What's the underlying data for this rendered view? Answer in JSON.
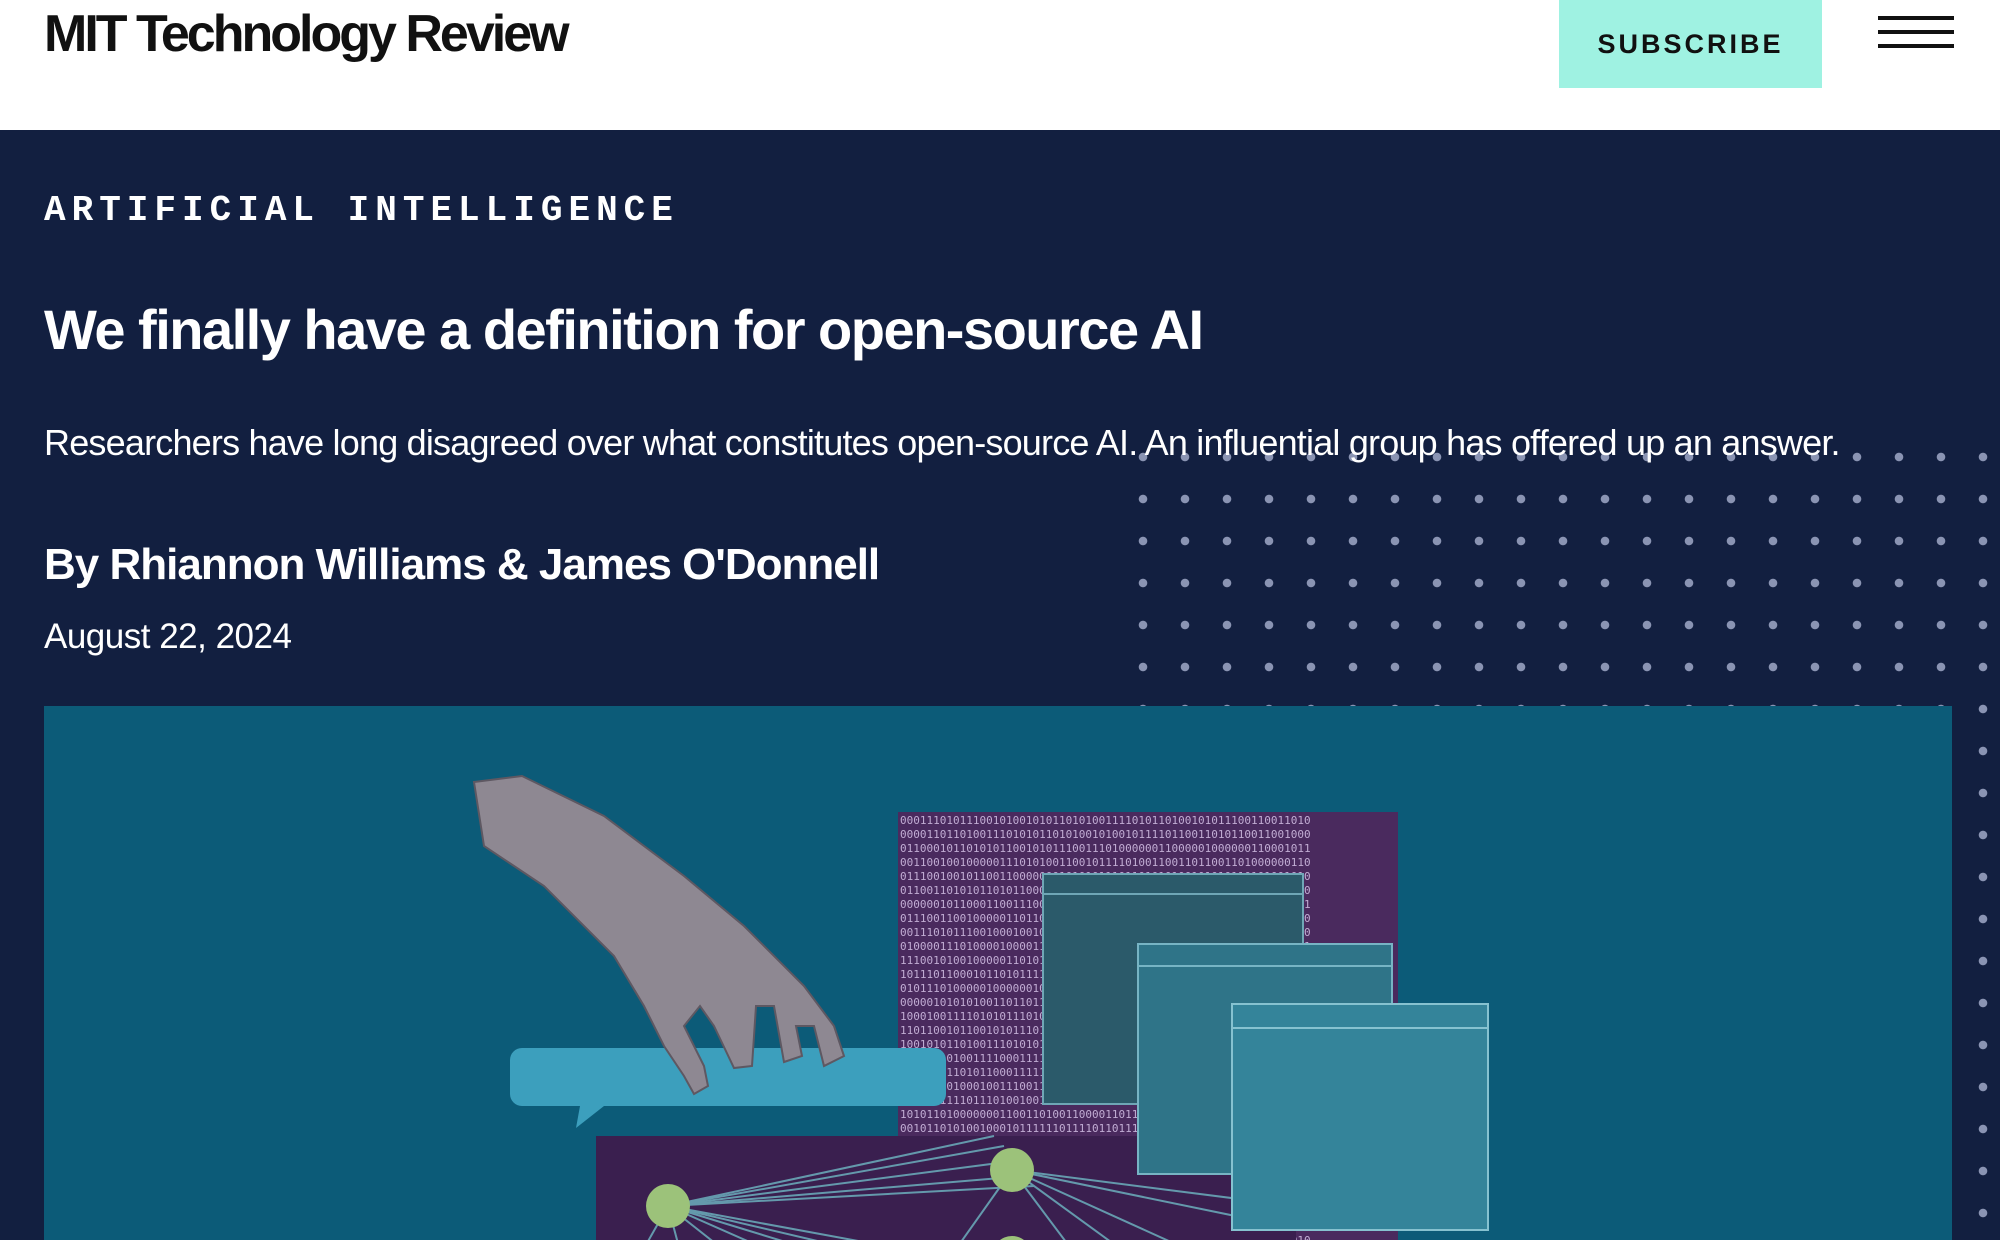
{
  "header": {
    "logo": "MIT Technology Review",
    "subscribe_label": "SUBSCRIBE",
    "menu_icon": "hamburger-menu-icon"
  },
  "article": {
    "category": "ARTIFICIAL INTELLIGENCE",
    "title": "We finally have a definition for open-source AI",
    "dek": "Researchers have long disagreed over what constitutes open-source AI. An influential group has offered up an answer.",
    "byline_prefix": "By ",
    "author1": "Rhiannon Williams",
    "byline_joiner": " & ",
    "author2": "James O'Donnell",
    "date": "August 22, 2024"
  },
  "colors": {
    "hero_background": "#121f40",
    "subscribe_background": "#9ff2e2",
    "image_background": "#0c5b78"
  }
}
